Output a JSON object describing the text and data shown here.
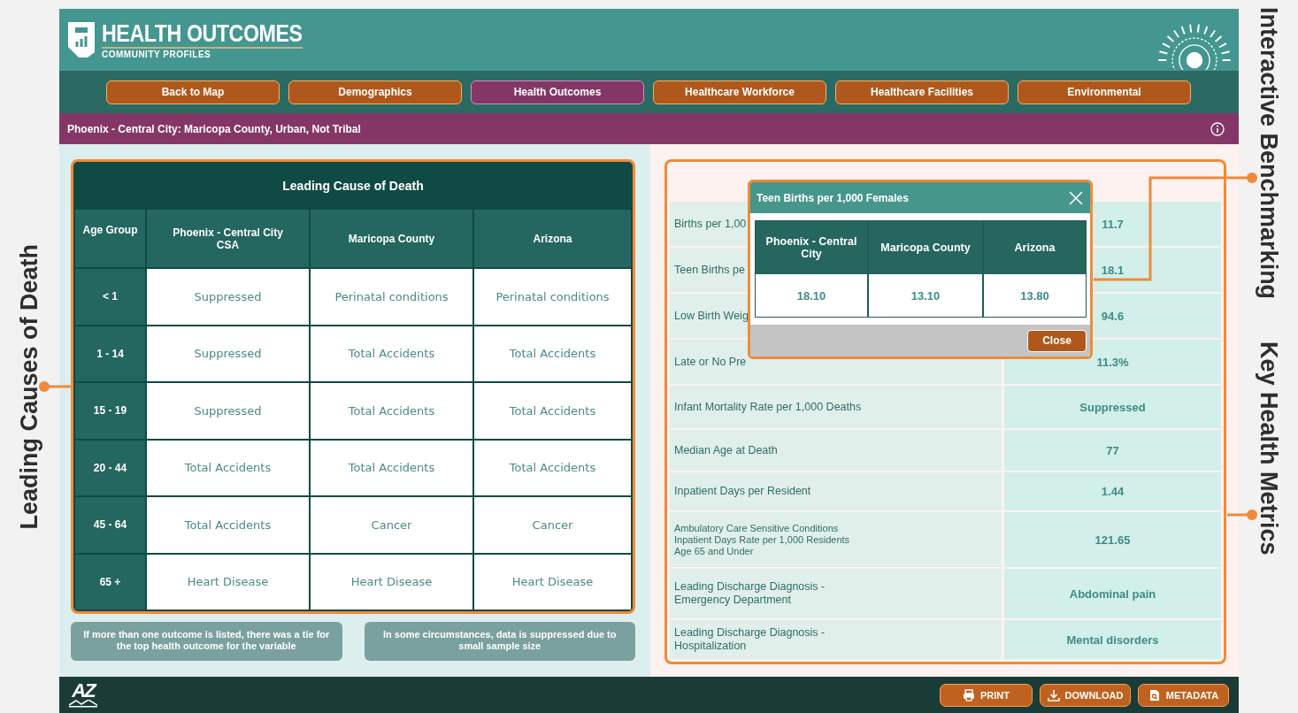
{
  "header": {
    "title": "HEALTH OUTCOMES",
    "subtitle": "COMMUNITY PROFILES"
  },
  "nav": [
    {
      "label": "Back to Map",
      "selected": false
    },
    {
      "label": "Demographics",
      "selected": false
    },
    {
      "label": "Health Outcomes",
      "selected": true
    },
    {
      "label": "Healthcare Workforce",
      "selected": false
    },
    {
      "label": "Healthcare Facilities",
      "selected": false
    },
    {
      "label": "Environmental",
      "selected": false
    }
  ],
  "location": "Phoenix - Central City: Maricopa County, Urban, Not Tribal",
  "cause_table": {
    "title": "Leading Cause of Death",
    "columns": [
      "Age Group",
      "Phoenix - Central City CSA",
      "Maricopa County",
      "Arizona"
    ],
    "rows": [
      [
        "< 1",
        "Suppressed",
        "Perinatal conditions",
        "Perinatal conditions"
      ],
      [
        "1 - 14",
        "Suppressed",
        "Total Accidents",
        "Total Accidents"
      ],
      [
        "15 - 19",
        "Suppressed",
        "Total Accidents",
        "Total Accidents"
      ],
      [
        "20 - 44",
        "Total Accidents",
        "Total Accidents",
        "Total Accidents"
      ],
      [
        "45 - 64",
        "Total Accidents",
        "Cancer",
        "Cancer"
      ],
      [
        "65 +",
        "Heart Disease",
        "Heart Disease",
        "Heart Disease"
      ]
    ]
  },
  "notes": [
    "If more than one outcome is listed, there was a tie for the top health outcome for the variable",
    "In some circumstances, data is suppressed due to small sample size"
  ],
  "metrics": {
    "rows": [
      {
        "label": "Births per 1,00",
        "value": "11.7",
        "kind": "standard"
      },
      {
        "label": "Teen Births pe",
        "value": "18.1",
        "kind": "standard"
      },
      {
        "label": "Low Birth Weig",
        "value": "94.6",
        "kind": "standard"
      },
      {
        "label": "Late or No Pre",
        "value": "11.3%",
        "kind": "standard"
      },
      {
        "label": "Infant Mortality Rate per 1,000 Deaths",
        "value": "Suppressed",
        "kind": "standard"
      },
      {
        "label": "Median Age at Death",
        "value": "77",
        "kind": "standard"
      },
      {
        "label": "Inpatient Days per Resident",
        "value": "1.44",
        "kind": "standard"
      },
      {
        "label": "Ambulatory Care Sensitive Conditions\nInpatient Days Rate per 1,000 Residents\nAge 65 and Under",
        "value": "121.65",
        "kind": "compact"
      },
      {
        "label": "Leading Discharge Diagnosis -\nEmergency Department",
        "value": "Abdominal pain",
        "kind": "standard"
      },
      {
        "label": "Leading Discharge Diagnosis -\nHospitalization",
        "value": "Mental disorders",
        "kind": "standard"
      }
    ]
  },
  "popup": {
    "title": "Teen Births per 1,000 Females",
    "columns": [
      "Phoenix - Central City",
      "Maricopa County",
      "Arizona"
    ],
    "values": [
      "18.10",
      "13.10",
      "13.80"
    ],
    "button": "Close"
  },
  "footer": {
    "logo": "AZ",
    "buttons": [
      {
        "kind": "print",
        "label": "PRINT"
      },
      {
        "kind": "download",
        "label": "DOWNLOAD"
      },
      {
        "kind": "metadata",
        "label": "METADATA"
      }
    ]
  },
  "callouts": [
    {
      "label": "Leading Causes of Death",
      "kind": "left"
    },
    {
      "label": "Interactive Benchmarking",
      "kind": "right-elbow"
    },
    {
      "label": "Key Health Metrics",
      "kind": "right-straight"
    }
  ]
}
